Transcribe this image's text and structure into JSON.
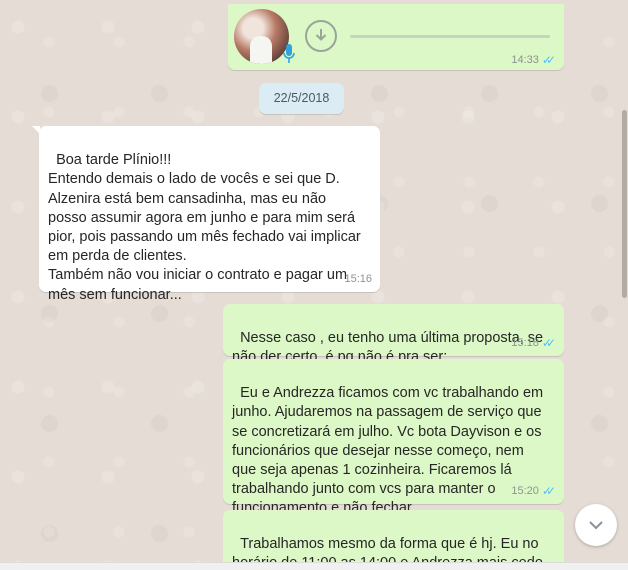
{
  "chat": {
    "voice_message": {
      "time": "14:33",
      "avatar": "contact-photo",
      "icon_download": "download-arrow-icon",
      "icon_mic": "mic-icon"
    },
    "date_divider": "22/5/2018",
    "messages": [
      {
        "direction": "in",
        "text": "Boa tarde Plínio!!!\nEntendo demais o lado de vocês e sei que D.\nAlzenira está bem cansadinha, mas eu não\nposso assumir agora em junho e para mim será\npior, pois passando um mês fechado vai implicar\nem perda de clientes.\nTambém não vou iniciar o contrato e pagar um\nmês sem funcionar...",
        "time": "15:16"
      },
      {
        "direction": "out",
        "text": "Nesse caso , eu tenho uma última proposta, se\nnão der certo, é pq não é pra ser:",
        "time": "15:18"
      },
      {
        "direction": "out",
        "text": "Eu e Andrezza ficamos com vc trabalhando em\njunho. Ajudaremos na passagem de serviço que\nse concretizará em julho. Vc bota Dayvison e os\nfuncionários que desejar nesse começo, nem\nque seja apenas 1 cozinheira. Ficaremos lá\ntrabalhando junto com vcs para manter o\nfuncionamento e não fechar.",
        "time": "15:20"
      },
      {
        "direction": "out",
        "text": "Trabalhamos mesmo da forma que é hj. Eu no\nhorário de 11:00 as 14:00 e Andrezza mais cedo\naté o fim da tarde.",
        "time": ""
      }
    ],
    "scroll_down_icon": "chevron-down-icon"
  },
  "colors": {
    "outgoing": "#dcf8c6",
    "incoming": "#ffffff",
    "read_ticks": "#4fc3f7",
    "wallpaper": "#e5ddd5"
  }
}
